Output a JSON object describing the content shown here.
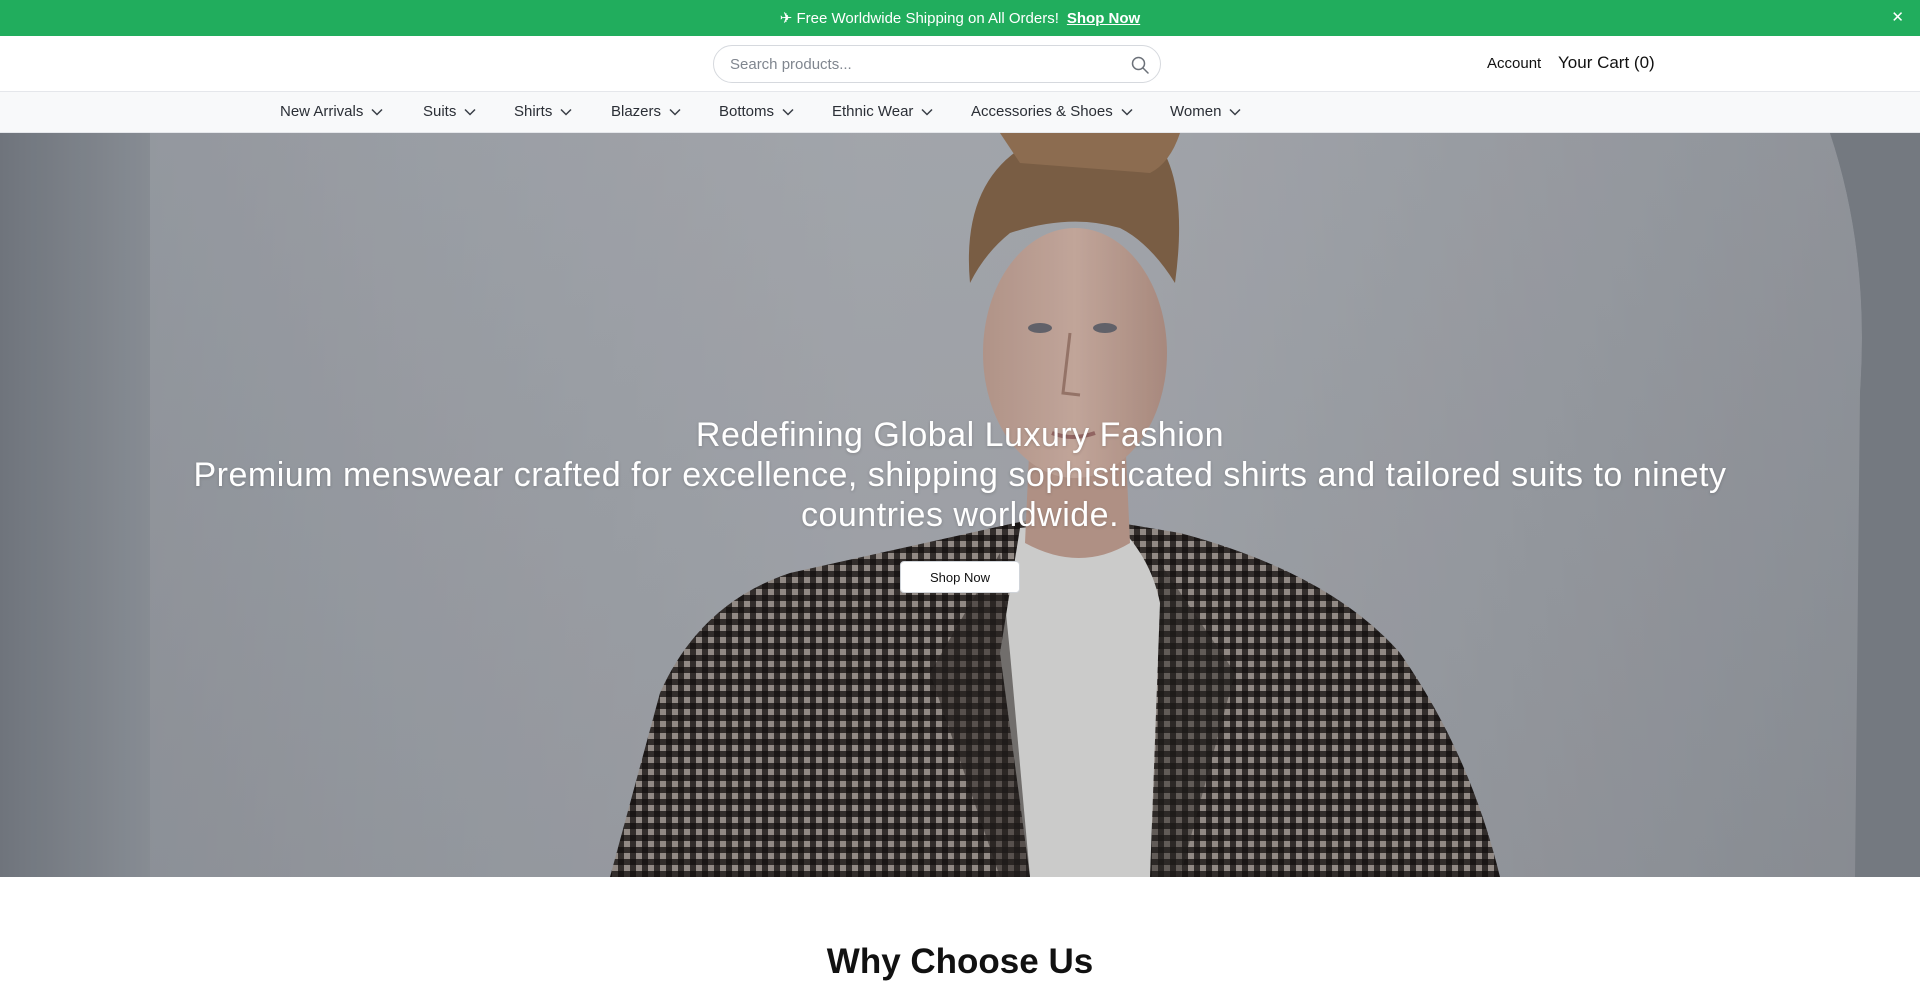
{
  "announcement": {
    "text": "✈ Free Worldwide Shipping on All Orders!",
    "link_label": "Shop Now",
    "close_label": "✕",
    "bg_color": "#21ad5d"
  },
  "header": {
    "search_placeholder": "Search products...",
    "account_label": "Account",
    "cart_label": "Your Cart (0)"
  },
  "nav": {
    "items": [
      {
        "label": "New Arrivals"
      },
      {
        "label": "Suits"
      },
      {
        "label": "Shirts"
      },
      {
        "label": "Blazers"
      },
      {
        "label": "Bottoms"
      },
      {
        "label": "Ethnic Wear"
      },
      {
        "label": "Accessories & Shoes"
      },
      {
        "label": "Women"
      }
    ]
  },
  "hero": {
    "title": "Redefining Global Luxury Fashion",
    "subtitle": "Premium menswear crafted for excellence, shipping sophisticated shirts and tailored suits to ninety countries worldwide.",
    "cta_label": "Shop Now"
  },
  "section": {
    "title": "Why Choose Us"
  },
  "icons": {
    "search": "search-icon",
    "chevron": "chevron-down-icon",
    "close": "close-icon"
  }
}
